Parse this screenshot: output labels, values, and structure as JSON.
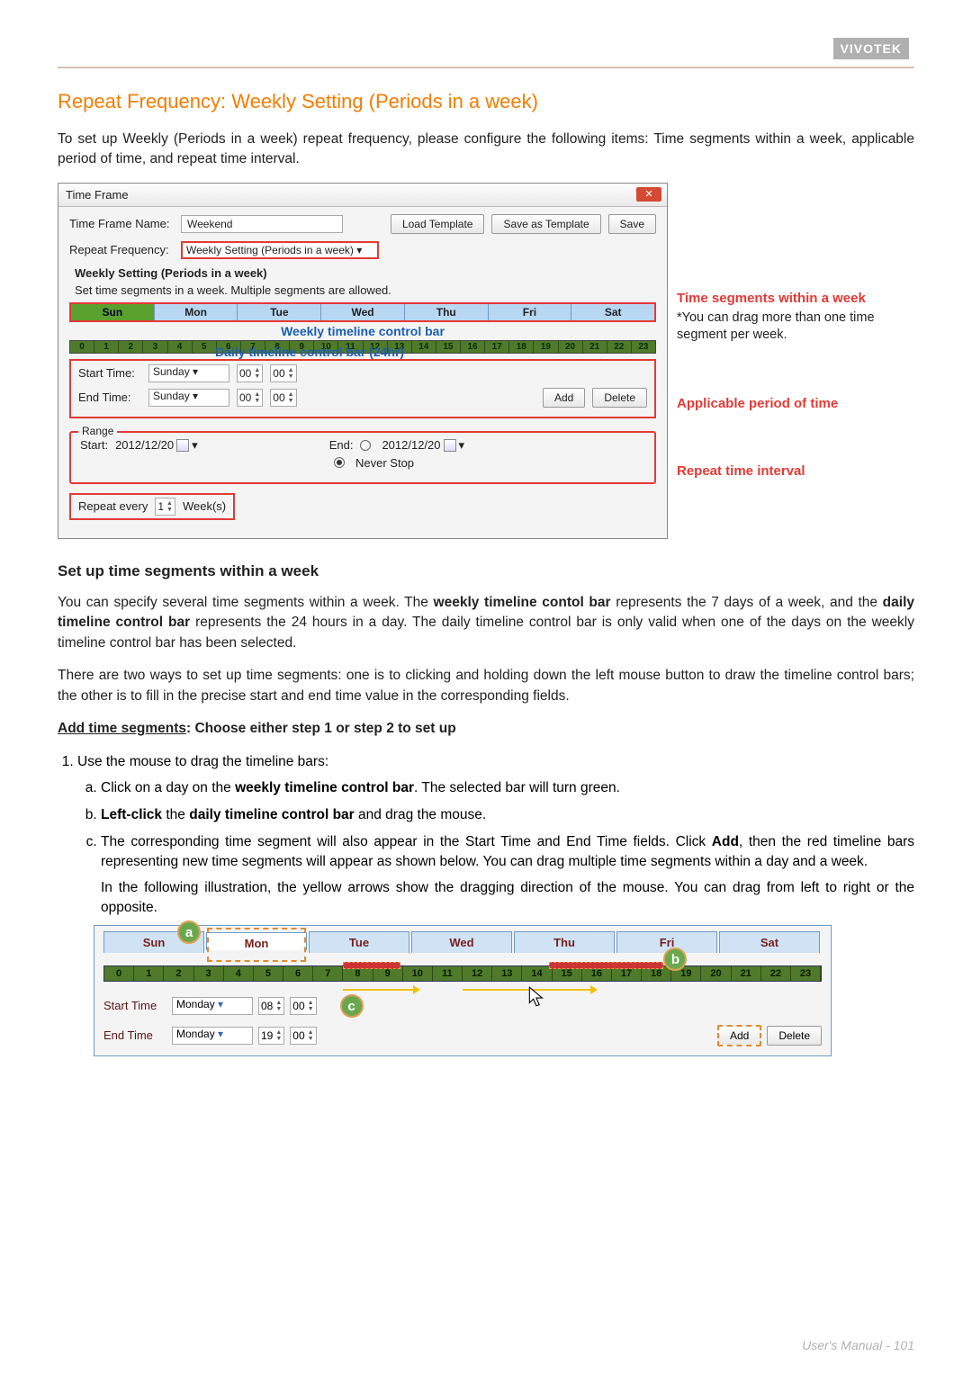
{
  "brand": "VIVOTEK",
  "section_title": "Repeat Frequency: Weekly Setting (Periods in a week)",
  "intro": "To set up Weekly (Periods in a week) repeat frequency, please configure the following items: Time segments within a week, applicable period of time, and repeat time interval.",
  "dialog": {
    "title": "Time Frame",
    "name_label": "Time Frame Name:",
    "name_value": "Weekend",
    "repeat_label": "Repeat Frequency:",
    "repeat_value": "Weekly Setting (Periods in a week)",
    "btn_load": "Load Template",
    "btn_saveas": "Save as Template",
    "btn_save": "Save",
    "group_title": "Weekly Setting (Periods in a week)",
    "desc": "Set time segments in a week. Multiple segments are allowed.",
    "days": [
      "Sun",
      "Mon",
      "Tue",
      "Wed",
      "Thu",
      "Fri",
      "Sat"
    ],
    "weekly_bar_label": "Weekly timeline control bar",
    "daily_bar_label": "Daily timeline control bar (24hr)",
    "hours": [
      "0",
      "1",
      "2",
      "3",
      "4",
      "5",
      "6",
      "7",
      "8",
      "9",
      "10",
      "11",
      "12",
      "13",
      "14",
      "15",
      "16",
      "17",
      "18",
      "19",
      "20",
      "21",
      "22",
      "23"
    ],
    "start_label": "Start Time:",
    "end_label": "End Time:",
    "start_day": "Sunday",
    "end_day": "Sunday",
    "start_h": "00",
    "start_m": "00",
    "end_h": "00",
    "end_m": "00",
    "btn_add": "Add",
    "btn_delete": "Delete",
    "range_legend": "Range",
    "range_start_label": "Start:",
    "range_start": "2012/12/20",
    "range_end_label": "End:",
    "range_end": "2012/12/20",
    "never_stop": "Never Stop",
    "repeat_every_label": "Repeat every",
    "repeat_every_value": "1",
    "repeat_unit": "Week(s)"
  },
  "annotations": {
    "seg_title": "Time segments within a week",
    "seg_note": "*You can drag more than one time segment per week.",
    "range_title": "Applicable period of time",
    "interval_title": "Repeat time interval"
  },
  "sub_h": "Set up time segments within a week",
  "para2": "You can specify several time segments within a week. The weekly timeline contol bar represents the 7 days of a week, and the daily timeline control bar represents the 24 hours in a day. The daily timeline control bar is only valid when one of the days on the weekly timeline control bar has been selected.",
  "para3": "There are two ways to set up time segments: one is to clicking and holding down the left mouse button to draw the timeline control bars; the other is to fill in the precise start and end time value in the corresponding fields.",
  "add_seg_title": "Add time segments: Choose either step 1 or step 2 to set up",
  "step1": "Use the mouse to drag the timeline bars:",
  "step1a_pre": "Click on a day on the ",
  "step1a_bold": "weekly timeline control bar",
  "step1a_post": ". The selected bar will turn green.",
  "step1b_pre": "Left-click",
  "step1b_mid": " the ",
  "step1b_bold": "daily timeline control bar",
  "step1b_post": " and drag the mouse.",
  "step1c": "The corresponding time segment will also appear in the Start Time and End Time fields. Click Add, then the red timeline bars representing new time segments will appear as shown below. You can drag multiple time segments within a day and a week.",
  "step1c_note": "In the following illustration, the yellow arrows show the dragging direction of the mouse. You can drag from left to right or the opposite.",
  "illus": {
    "days": [
      "Sun",
      "Mon",
      "Tue",
      "Wed",
      "Thu",
      "Fri",
      "Sat"
    ],
    "hours": [
      "0",
      "1",
      "2",
      "3",
      "4",
      "5",
      "6",
      "7",
      "8",
      "9",
      "10",
      "11",
      "12",
      "13",
      "14",
      "15",
      "16",
      "17",
      "18",
      "19",
      "20",
      "21",
      "22",
      "23"
    ],
    "start_label": "Start Time",
    "end_label": "End Time",
    "start_day": "Monday",
    "end_day": "Monday",
    "start_h": "08",
    "start_m": "00",
    "end_h": "19",
    "end_m": "00",
    "btn_add": "Add",
    "btn_delete": "Delete"
  },
  "footer": "User's Manual - 101"
}
